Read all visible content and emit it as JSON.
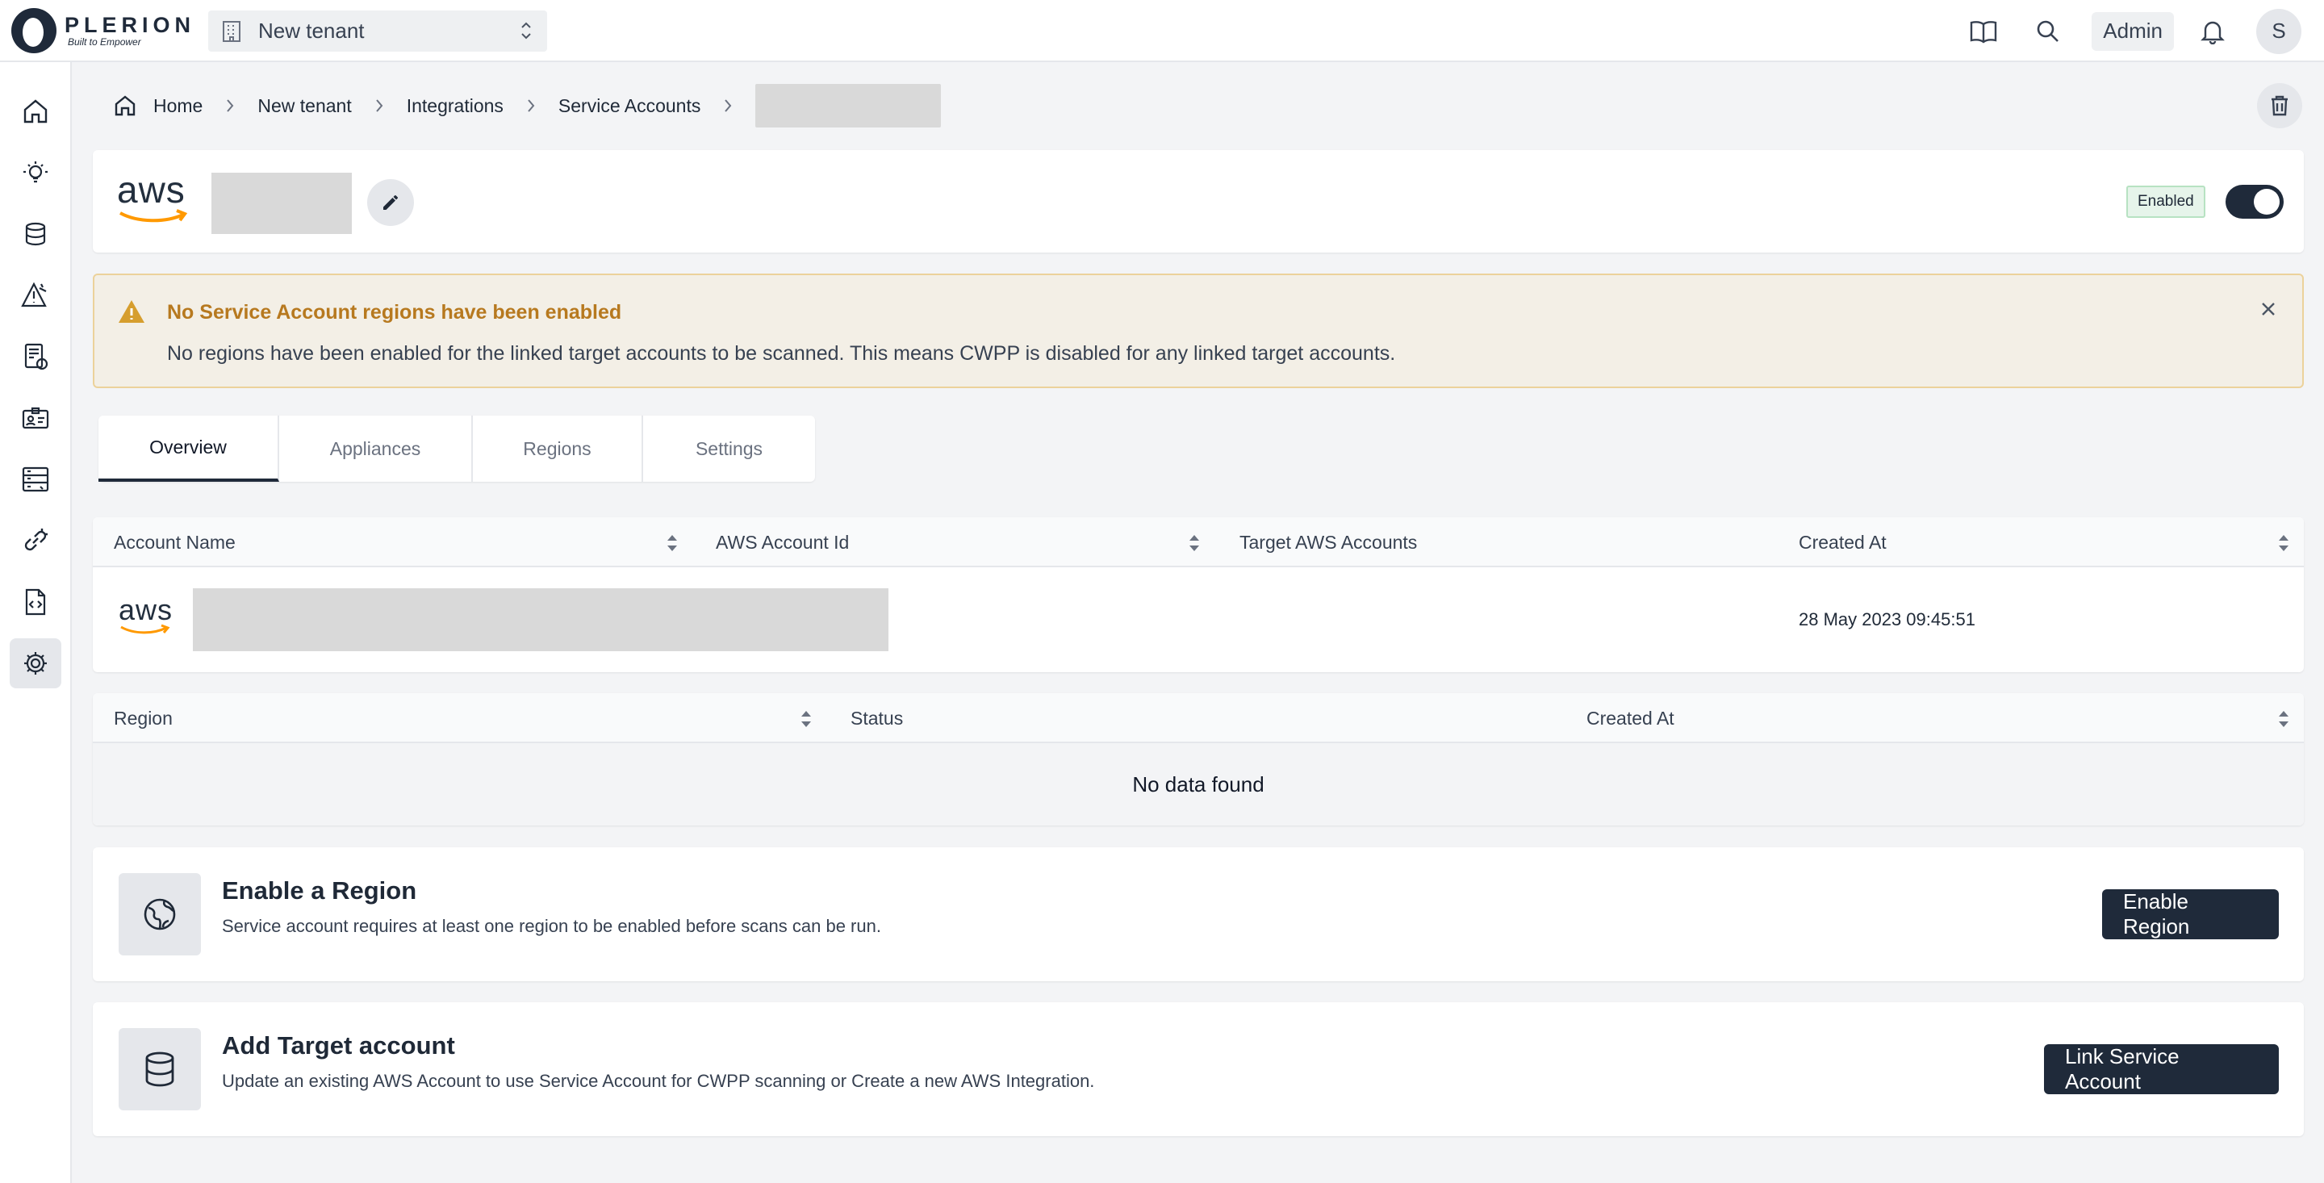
{
  "brand": {
    "name": "PLERION",
    "tagline": "Built to Empower"
  },
  "topbar": {
    "tenant": "New tenant",
    "admin_label": "Admin",
    "avatar_initial": "S"
  },
  "breadcrumb": {
    "home": "Home",
    "tenant": "New tenant",
    "integrations": "Integrations",
    "service_accounts": "Service Accounts"
  },
  "header": {
    "logo_text": "aws",
    "status": "Enabled"
  },
  "alert": {
    "title": "No Service Account regions have been enabled",
    "body": "No regions have been enabled for the linked target accounts to be scanned. This means CWPP is disabled for any linked target accounts."
  },
  "tabs": [
    {
      "label": "Overview"
    },
    {
      "label": "Appliances"
    },
    {
      "label": "Regions"
    },
    {
      "label": "Settings"
    }
  ],
  "accounts_table": {
    "columns": [
      "Account Name",
      "AWS Account Id",
      "Target AWS Accounts",
      "Created At"
    ],
    "rows": [
      {
        "logo": "aws",
        "created_at": "28 May 2023 09:45:51"
      }
    ]
  },
  "regions_table": {
    "columns": [
      "Region",
      "Status",
      "Created At"
    ],
    "empty_message": "No data found"
  },
  "enable_region": {
    "title": "Enable a Region",
    "description": "Service account requires at least one region to be enabled before scans can be run.",
    "button": "Enable Region"
  },
  "add_target": {
    "title": "Add Target account",
    "description": "Update an existing AWS Account to use Service Account for CWPP scanning or Create a new AWS Integration.",
    "button": "Link Service Account"
  },
  "colors": {
    "accent": "#1f2a3a",
    "warning": "#b7791f",
    "aws_orange": "#ff9900"
  }
}
